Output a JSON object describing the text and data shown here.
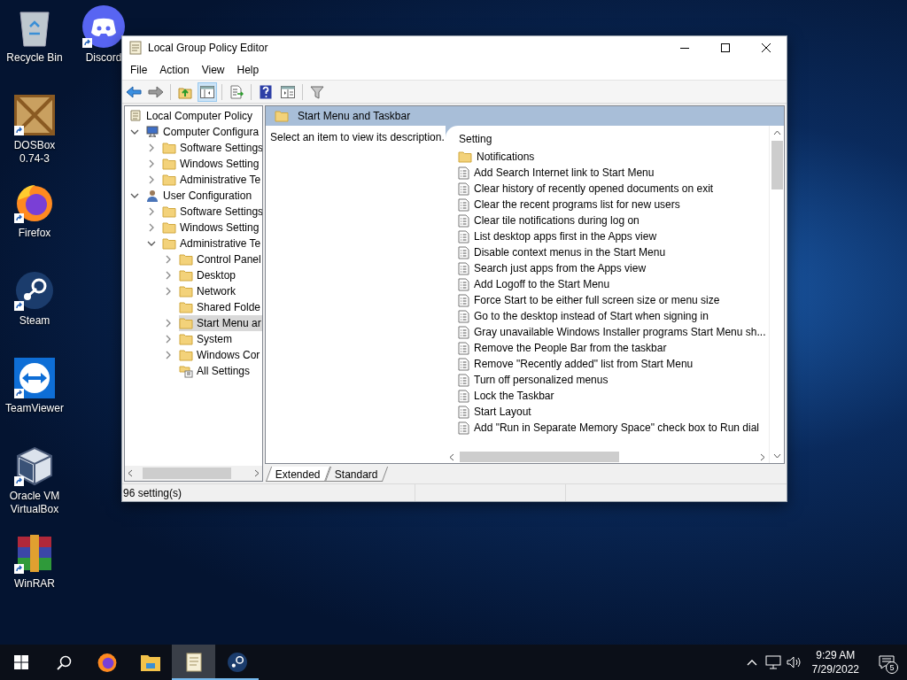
{
  "desktop_icons": [
    {
      "kind": "recycle-bin",
      "label": "Recycle Bin",
      "shortcut": false
    },
    {
      "kind": "dosbox",
      "label": "DOSBox 0.74-3",
      "shortcut": true
    },
    {
      "kind": "firefox",
      "label": "Firefox",
      "shortcut": true
    },
    {
      "kind": "steam",
      "label": "Steam",
      "shortcut": true
    },
    {
      "kind": "teamviewer",
      "label": "TeamViewer",
      "shortcut": true
    },
    {
      "kind": "virtualbox",
      "label": "Oracle VM VirtualBox",
      "shortcut": true
    },
    {
      "kind": "winrar",
      "label": "WinRAR",
      "shortcut": true
    },
    {
      "kind": "discord",
      "label": "Discord",
      "shortcut": true
    }
  ],
  "window": {
    "title": "Local Group Policy Editor"
  },
  "menu": [
    "File",
    "Action",
    "View",
    "Help"
  ],
  "toolbar": [
    {
      "kind": "back",
      "pressed": false
    },
    {
      "kind": "forward",
      "pressed": false
    },
    {
      "kind": "sep"
    },
    {
      "kind": "up",
      "pressed": false
    },
    {
      "kind": "tree",
      "pressed": true
    },
    {
      "kind": "sep"
    },
    {
      "kind": "export",
      "pressed": false
    },
    {
      "kind": "sep"
    },
    {
      "kind": "help",
      "pressed": false
    },
    {
      "kind": "view",
      "pressed": false
    },
    {
      "kind": "sep"
    },
    {
      "kind": "filter",
      "pressed": false
    }
  ],
  "tree": {
    "label": "Local Computer Policy",
    "kind": "policy",
    "selected": false,
    "children": [
      {
        "label": "Computer Configura",
        "kind": "computer",
        "expanded": true,
        "selected": false,
        "children": [
          {
            "label": "Software Settings",
            "kind": "folder",
            "expanded": false,
            "selected": false
          },
          {
            "label": "Windows Setting",
            "kind": "folder",
            "expanded": false,
            "selected": false
          },
          {
            "label": "Administrative Te",
            "kind": "folder",
            "expanded": false,
            "selected": false
          }
        ]
      },
      {
        "label": "User Configuration",
        "kind": "user",
        "expanded": true,
        "selected": false,
        "children": [
          {
            "label": "Software Settings",
            "kind": "folder",
            "expanded": false,
            "selected": false
          },
          {
            "label": "Windows Setting",
            "kind": "folder",
            "expanded": false,
            "selected": false
          },
          {
            "label": "Administrative Te",
            "kind": "folder",
            "expanded": true,
            "selected": false,
            "children": [
              {
                "label": "Control Panel",
                "kind": "folder",
                "expanded": false,
                "selected": false
              },
              {
                "label": "Desktop",
                "kind": "folder",
                "expanded": false,
                "selected": false
              },
              {
                "label": "Network",
                "kind": "folder",
                "expanded": false,
                "selected": false
              },
              {
                "label": "Shared Folde",
                "kind": "folder",
                "selected": false
              },
              {
                "label": "Start Menu ar",
                "kind": "folder",
                "expanded": false,
                "selected": true
              },
              {
                "label": "System",
                "kind": "folder",
                "expanded": false,
                "selected": false
              },
              {
                "label": "Windows Cor",
                "kind": "folder",
                "expanded": false,
                "selected": false
              },
              {
                "label": "All Settings",
                "kind": "all-settings",
                "selected": false
              }
            ]
          }
        ]
      }
    ]
  },
  "pane": {
    "title": "Start Menu and Taskbar",
    "description": "Select an item to view its description.",
    "column": "Setting",
    "rows": [
      {
        "kind": "folder",
        "label": "Notifications"
      },
      {
        "kind": "setting",
        "label": "Add Search Internet link to Start Menu"
      },
      {
        "kind": "setting",
        "label": "Clear history of recently opened documents on exit"
      },
      {
        "kind": "setting",
        "label": "Clear the recent programs list for new users"
      },
      {
        "kind": "setting",
        "label": "Clear tile notifications during log on"
      },
      {
        "kind": "setting",
        "label": "List desktop apps first in the Apps view"
      },
      {
        "kind": "setting",
        "label": "Disable context menus in the Start Menu"
      },
      {
        "kind": "setting",
        "label": "Search just apps from the Apps view"
      },
      {
        "kind": "setting",
        "label": "Add Logoff to the Start Menu"
      },
      {
        "kind": "setting",
        "label": "Force Start to be either full screen size or menu size"
      },
      {
        "kind": "setting",
        "label": "Go to the desktop instead of Start when signing in"
      },
      {
        "kind": "setting",
        "label": "Gray unavailable Windows Installer programs Start Menu sh..."
      },
      {
        "kind": "setting",
        "label": "Remove the People Bar from the taskbar"
      },
      {
        "kind": "setting",
        "label": "Remove \"Recently added\" list from Start Menu"
      },
      {
        "kind": "setting",
        "label": "Turn off personalized menus"
      },
      {
        "kind": "setting",
        "label": "Lock the Taskbar"
      },
      {
        "kind": "setting",
        "label": "Start Layout"
      },
      {
        "kind": "setting",
        "label": "Add \"Run in Separate Memory Space\" check box to Run dial"
      }
    ],
    "tabs": [
      {
        "label": "Extended",
        "selected": true
      },
      {
        "label": "Standard",
        "selected": false
      }
    ]
  },
  "status_bar": "96 setting(s)",
  "taskbar": {
    "apps": [
      {
        "kind": "firefox",
        "open": false,
        "active": false
      },
      {
        "kind": "explorer",
        "open": false,
        "active": false
      },
      {
        "kind": "policy",
        "open": true,
        "active": true
      },
      {
        "kind": "steam",
        "open": true,
        "active": false
      }
    ],
    "time": "9:29 AM",
    "date": "7/29/2022",
    "notifications": "5"
  }
}
